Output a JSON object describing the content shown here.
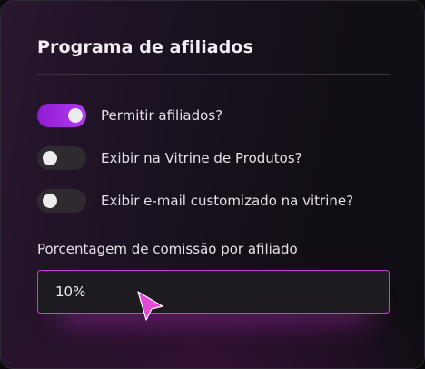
{
  "panel": {
    "title": "Programa de afiliados"
  },
  "toggles": [
    {
      "label": "Permitir afiliados?",
      "enabled": true
    },
    {
      "label": "Exibir na Vitrine de Produtos?",
      "enabled": false
    },
    {
      "label": "Exibir e-mail customizado na vitrine?",
      "enabled": false
    }
  ],
  "commission": {
    "label": "Porcentagem de comissão por afiliado",
    "value": "10%"
  },
  "colors": {
    "accent": "#b43cf0",
    "field_border": "#c73ddb",
    "cursor": "#e24ad6"
  },
  "icons": {
    "pointer": "cursor-arrow-icon"
  }
}
